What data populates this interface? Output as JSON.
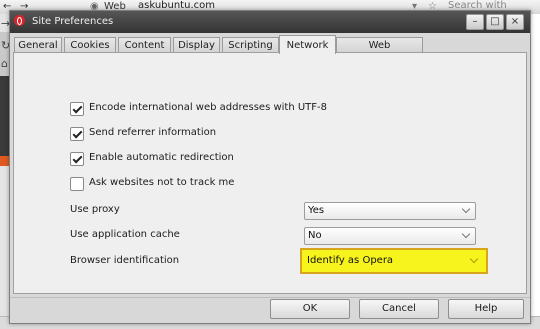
{
  "browser": {
    "tab_label": "Web",
    "url": "askubuntu.com",
    "search_placeholder": "Search with Google",
    "nav_arrows": "→",
    "reload": "↻"
  },
  "dialog": {
    "title": "Site Preferences",
    "tabs": [
      {
        "label": "General"
      },
      {
        "label": "Cookies"
      },
      {
        "label": "Content"
      },
      {
        "label": "Display"
      },
      {
        "label": "Scripting"
      },
      {
        "label": "Network",
        "active": true
      },
      {
        "label": "Web Applications"
      }
    ],
    "checkboxes": [
      {
        "label": "Encode international web addresses with UTF-8",
        "checked": true
      },
      {
        "label": "Send referrer information",
        "checked": true
      },
      {
        "label": "Enable automatic redirection",
        "checked": true
      },
      {
        "label": "Ask websites not to track me",
        "checked": false
      }
    ],
    "fields": [
      {
        "label": "Use proxy",
        "value": "Yes"
      },
      {
        "label": "Use application cache",
        "value": "No"
      },
      {
        "label": "Browser identification",
        "value": "Identify as Opera",
        "highlighted": true
      }
    ],
    "buttons": {
      "ok": "OK",
      "cancel": "Cancel",
      "help": "Help"
    },
    "titlebar_buttons": {
      "minimize": "–",
      "maximize": "□",
      "close": "×"
    }
  },
  "colors": {
    "highlight": "#f6f41c",
    "highlight_border": "#d8a51f",
    "opera_red": "#d6242a"
  }
}
